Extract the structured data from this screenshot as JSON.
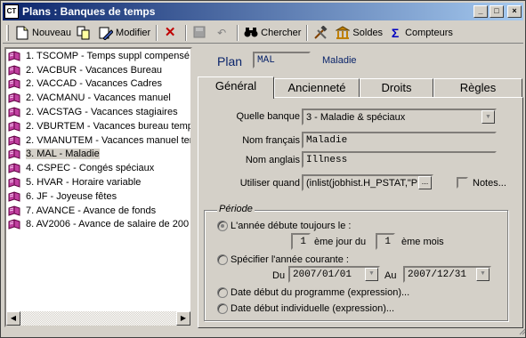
{
  "window": {
    "title": "Plans : Banques de temps",
    "app_icon": "CT",
    "controls": [
      "_",
      "□",
      "×"
    ]
  },
  "toolbar": {
    "nouveau": "Nouveau",
    "modifier": "Modifier",
    "chercher": "Chercher",
    "soldes": "Soldes",
    "compteurs": "Compteurs"
  },
  "list": {
    "items": [
      {
        "label": "1. TSCOMP - Temps suppl compensé"
      },
      {
        "label": "2. VACBUR - Vacances Bureau"
      },
      {
        "label": "2. VACCAD - Vacances Cadres"
      },
      {
        "label": "2. VACMANU - Vacances manuel"
      },
      {
        "label": "2. VACSTAG - Vacances stagiaires"
      },
      {
        "label": "2. VBURTEM - Vacances bureau temp"
      },
      {
        "label": "2. VMANUTEM - Vacances manuel ten"
      },
      {
        "label": "3. MAL - Maladie"
      },
      {
        "label": "4. CSPEC - Congés spéciaux"
      },
      {
        "label": "5. HVAR - Horaire variable"
      },
      {
        "label": "6. JF - Joyeuse fêtes"
      },
      {
        "label": "7. AVANCE - Avance de fonds"
      },
      {
        "label": "8. AV2006 - Avance de salaire de 200"
      }
    ],
    "selected_index": 7
  },
  "plan": {
    "label": "Plan",
    "code": "MAL",
    "name": "Maladie"
  },
  "tabs": [
    "Général",
    "Ancienneté",
    "Droits",
    "Règles"
  ],
  "general": {
    "quelle_banque_label": "Quelle banque",
    "quelle_banque_value": "3 - Maladie & spéciaux",
    "nom_francais_label": "Nom français",
    "nom_francais_value": "Maladie",
    "nom_anglais_label": "Nom anglais",
    "nom_anglais_value": "Illness",
    "utiliser_quand_label": "Utiliser quand",
    "utiliser_quand_value": "(inlist(jobhist.H_PSTAT,\"P",
    "dots_label": "...",
    "notes_label": "Notes..."
  },
  "periode": {
    "title": "Période",
    "option1_label": "L'année débute toujours le :",
    "jour_value": "1",
    "jour_suffix": "ème jour du",
    "mois_value": "1",
    "mois_suffix": "ème mois",
    "option2_label": "Spécifier l'année courante :",
    "du_label": "Du",
    "du_value": "2007/01/01",
    "au_label": "Au",
    "au_value": "2007/12/31",
    "option3_label": "Date début du programme (expression)...",
    "option4_label": "Date début individuelle (expression)..."
  }
}
